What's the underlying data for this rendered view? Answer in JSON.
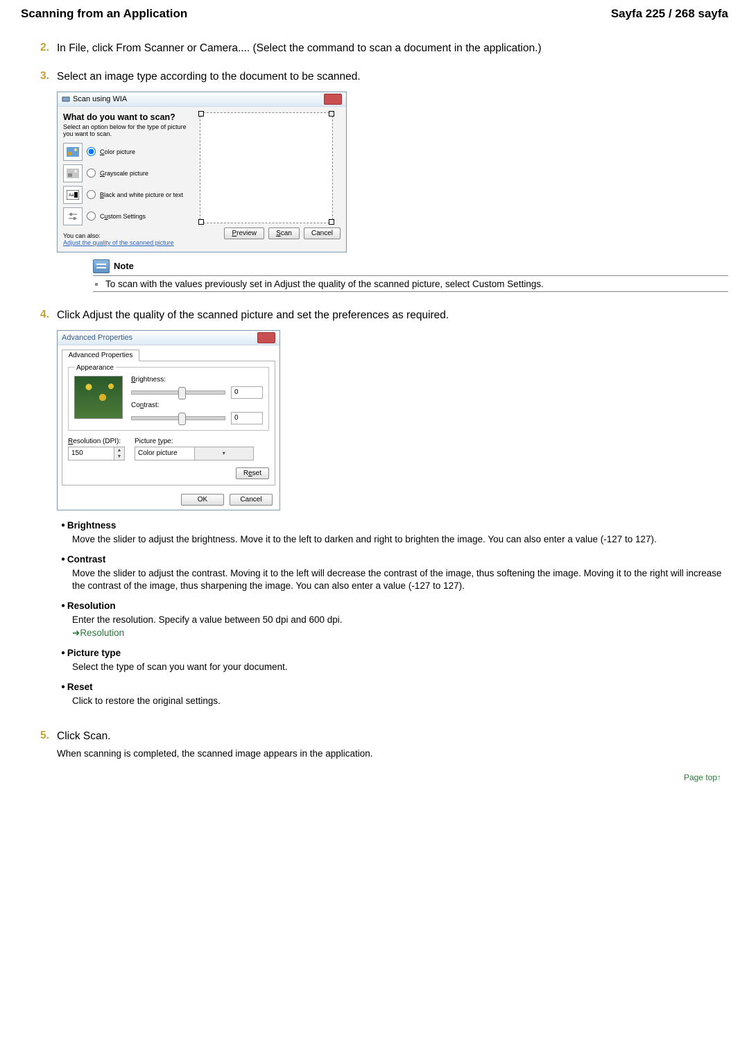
{
  "header": {
    "left": "Scanning from an Application",
    "right": "Sayfa 225 / 268 sayfa"
  },
  "steps": {
    "s2": {
      "num": "2.",
      "text": "In File, click From Scanner or Camera.... (Select the command to scan a document in the application.)"
    },
    "s3": {
      "num": "3.",
      "text": "Select an image type according to the document to be scanned."
    },
    "s4": {
      "num": "4.",
      "text": "Click Adjust the quality of the scanned picture and set the preferences as required."
    },
    "s5": {
      "num": "5.",
      "text": "Click Scan.",
      "after": "When scanning is completed, the scanned image appears in the application."
    }
  },
  "wia": {
    "title": "Scan using WIA",
    "question": "What do you want to scan?",
    "subtext": "Select an option below for the type of picture you want to scan.",
    "opt_color": "Color picture",
    "opt_gray": "Grayscale picture",
    "opt_bw": "Black and white picture or text",
    "opt_custom": "Custom Settings",
    "also": "You can also:",
    "adjust_link": "Adjust the quality of the scanned picture",
    "btn_preview": "Preview",
    "btn_scan": "Scan",
    "btn_cancel": "Cancel"
  },
  "note": {
    "label": "Note",
    "text": "To scan with the values previously set in Adjust the quality of the scanned picture, select Custom Settings."
  },
  "adv": {
    "title": "Advanced Properties",
    "tab": "Advanced Properties",
    "appearance": "Appearance",
    "brightness_label": "Brightness:",
    "brightness_value": "0",
    "contrast_label": "Contrast:",
    "contrast_value": "0",
    "resolution_label": "Resolution (DPI):",
    "resolution_value": "150",
    "ptype_label": "Picture type:",
    "ptype_value": "Color picture",
    "reset": "Reset",
    "ok": "OK",
    "cancel": "Cancel"
  },
  "desc": {
    "brightness": {
      "t": "Brightness",
      "d": "Move the slider to adjust the brightness. Move it to the left to darken and right to brighten the image. You can also enter a value (-127 to 127)."
    },
    "contrast": {
      "t": "Contrast",
      "d": "Move the slider to adjust the contrast. Moving it to the left will decrease the contrast of the image, thus softening the image. Moving it to the right will increase the contrast of the image, thus sharpening the image. You can also enter a value (-127 to 127)."
    },
    "resolution": {
      "t": "Resolution",
      "d": "Enter the resolution. Specify a value between 50 dpi and 600 dpi.",
      "link": "Resolution"
    },
    "ptype": {
      "t": "Picture type",
      "d": "Select the type of scan you want for your document."
    },
    "reset": {
      "t": "Reset",
      "d": "Click to restore the original settings."
    }
  },
  "pagetop": "Page top"
}
